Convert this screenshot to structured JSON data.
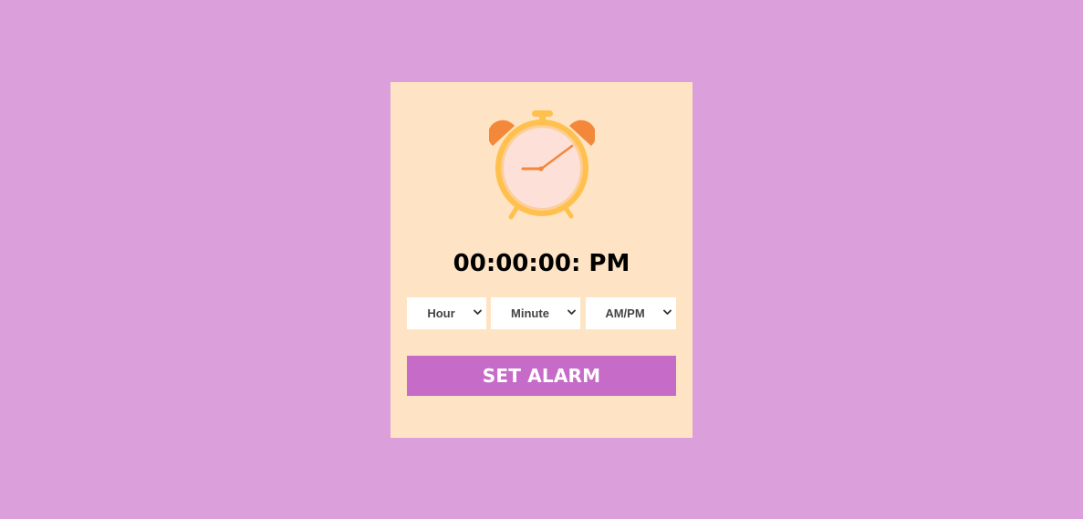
{
  "clock": {
    "time_text": "00:00:00: PM"
  },
  "selects": {
    "hour": "Hour",
    "minute": "Minute",
    "ampm": "AM/PM"
  },
  "button": {
    "label": "SET ALARM"
  },
  "colors": {
    "background": "#dba0dc",
    "card": "#fee4c4",
    "button": "#c76bc8",
    "clock_frame": "#ffc04d",
    "clock_face": "#fde0d8",
    "clock_bells": "#f3883a",
    "clock_hands": "#f3883a"
  },
  "icons": {
    "illustration": "alarm-clock-icon",
    "select_arrow": "chevron-down-icon"
  }
}
